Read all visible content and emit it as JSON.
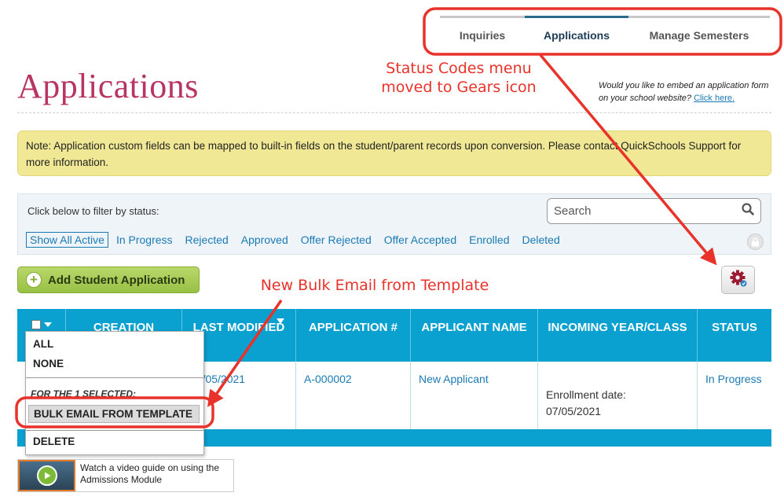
{
  "tabs": [
    {
      "label": "Inquiries",
      "active": false
    },
    {
      "label": "Applications",
      "active": true
    },
    {
      "label": "Manage Semesters",
      "active": false
    }
  ],
  "page_title": "Applications",
  "embed": {
    "text": "Would you like to embed an application form on your school website?",
    "link": "Click here."
  },
  "note": "Note: Application custom fields can be mapped to built-in fields on the student/parent records upon conversion. Please contact QuickSchools Support for more information.",
  "filter": {
    "label": "Click below to filter by status:",
    "search_placeholder": "Search",
    "statuses": [
      "Show All Active",
      "In Progress",
      "Rejected",
      "Approved",
      "Offer Rejected",
      "Offer Accepted",
      "Enrolled",
      "Deleted"
    ],
    "active_status": "Show All Active"
  },
  "add_button": "Add Student Application",
  "table": {
    "headers": {
      "creation": "CREATION",
      "last_modified": "LAST MODIFIED",
      "application": "APPLICATION #",
      "applicant": "APPLICANT NAME",
      "incoming": "INCOMING YEAR/CLASS",
      "status": "STATUS"
    },
    "row": {
      "last_modified": "07/05/2021",
      "application": "A-000002",
      "applicant": "New Applicant",
      "incoming_label": "Enrollment date:",
      "incoming_date": "07/05/2021",
      "status": "In Progress"
    }
  },
  "dropdown": {
    "all": "ALL",
    "none": "NONE",
    "selected_heading": "FOR THE 1 SELECTED:",
    "bulk_email": "BULK EMAIL FROM TEMPLATE",
    "delete": "DELETE"
  },
  "video": {
    "text": "Watch a video guide on using the Admissions Module"
  },
  "annotations": {
    "status_codes": "Status Codes menu moved to Gears icon",
    "bulk_email": "New Bulk Email from Template",
    "color": "#e8322a"
  }
}
